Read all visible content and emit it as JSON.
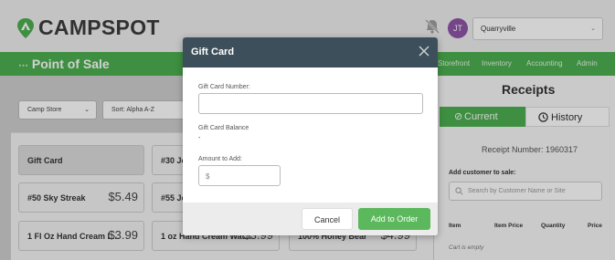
{
  "header": {
    "logo_text": "CAMPSPOT",
    "avatar_initials": "JT",
    "location_select": "Quarryville"
  },
  "toolbar": {
    "title": "Point of Sale",
    "nav": [
      "Storefront",
      "Inventory",
      "Accounting",
      "Admin"
    ]
  },
  "filters": {
    "store": "Camp Store",
    "sort": "Sort: Alpha A-Z"
  },
  "products": [
    {
      "name": "Gift Card",
      "price": ""
    },
    {
      "name": "#30 Je",
      "price": ""
    },
    {
      "name": "#50 Sky Streak",
      "price": "$5.49"
    },
    {
      "name": "#55 Je",
      "price": ""
    },
    {
      "name": "1 Fl Oz Hand Cream L...",
      "price": "$3.99"
    },
    {
      "name": "1 oz Hand Cream Wat...",
      "price": "$3.99"
    },
    {
      "name": "100% Honey Bear",
      "price": "$4.99"
    }
  ],
  "receipts": {
    "title": "Receipts",
    "tab_current": "Current",
    "tab_history": "History",
    "receipt_number": "Receipt Number: 1960317",
    "add_customer_label": "Add customer to sale:",
    "customer_placeholder": "Search by Customer Name or Site",
    "columns": [
      "Item",
      "Item Price",
      "Quantity",
      "Price"
    ],
    "cart_empty": "Cart is empty"
  },
  "modal": {
    "title": "Gift Card",
    "card_number_label": "Gift Card Number:",
    "card_number_value": "",
    "balance_label": "Gift Card Balance",
    "balance_value": "-",
    "amount_label": "Amount to Add:",
    "amount_placeholder": "$",
    "cancel_label": "Cancel",
    "add_label": "Add to Order"
  },
  "colors": {
    "brand_green": "#4caf50",
    "modal_header": "#3d4f5a",
    "add_button": "#5cb85c",
    "avatar": "#8e55a8"
  }
}
